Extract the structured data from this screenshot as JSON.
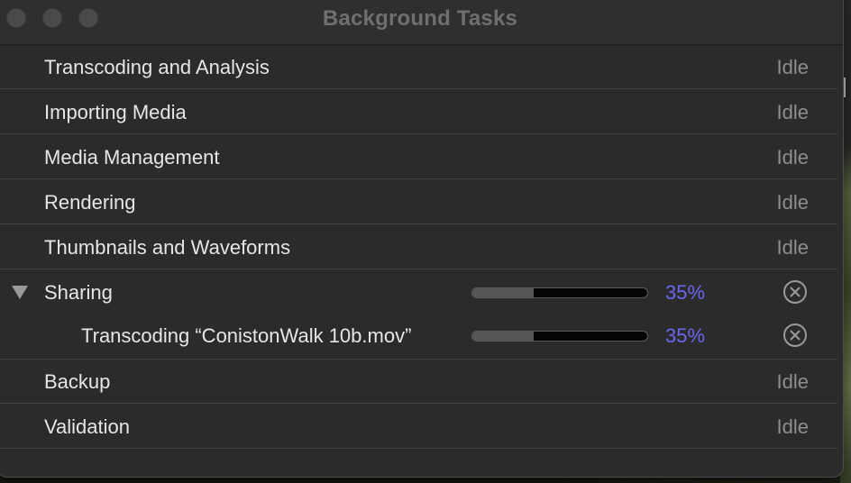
{
  "window": {
    "title": "Background Tasks"
  },
  "tasks": [
    {
      "label": "Transcoding and Analysis",
      "status": "Idle"
    },
    {
      "label": "Importing Media",
      "status": "Idle"
    },
    {
      "label": "Media Management",
      "status": "Idle"
    },
    {
      "label": "Rendering",
      "status": "Idle"
    },
    {
      "label": "Thumbnails and Waveforms",
      "status": "Idle"
    }
  ],
  "sharing": {
    "label": "Sharing",
    "progress_percent": "35%",
    "progress_fraction": 0.35,
    "expanded": true,
    "subtask": {
      "label": "Transcoding “ConistonWalk 10b.mov”",
      "progress_percent": "35%",
      "progress_fraction": 0.35
    }
  },
  "tasks_after": [
    {
      "label": "Backup",
      "status": "Idle"
    },
    {
      "label": "Validation",
      "status": "Idle"
    }
  ],
  "colors": {
    "accent": "#6a66f0",
    "idle_text": "#8e8e8e",
    "label_text": "#e6e6e6"
  },
  "icons": {
    "cancel": "cancel-circle-x-icon",
    "disclosure": "disclosure-triangle-down-icon"
  }
}
